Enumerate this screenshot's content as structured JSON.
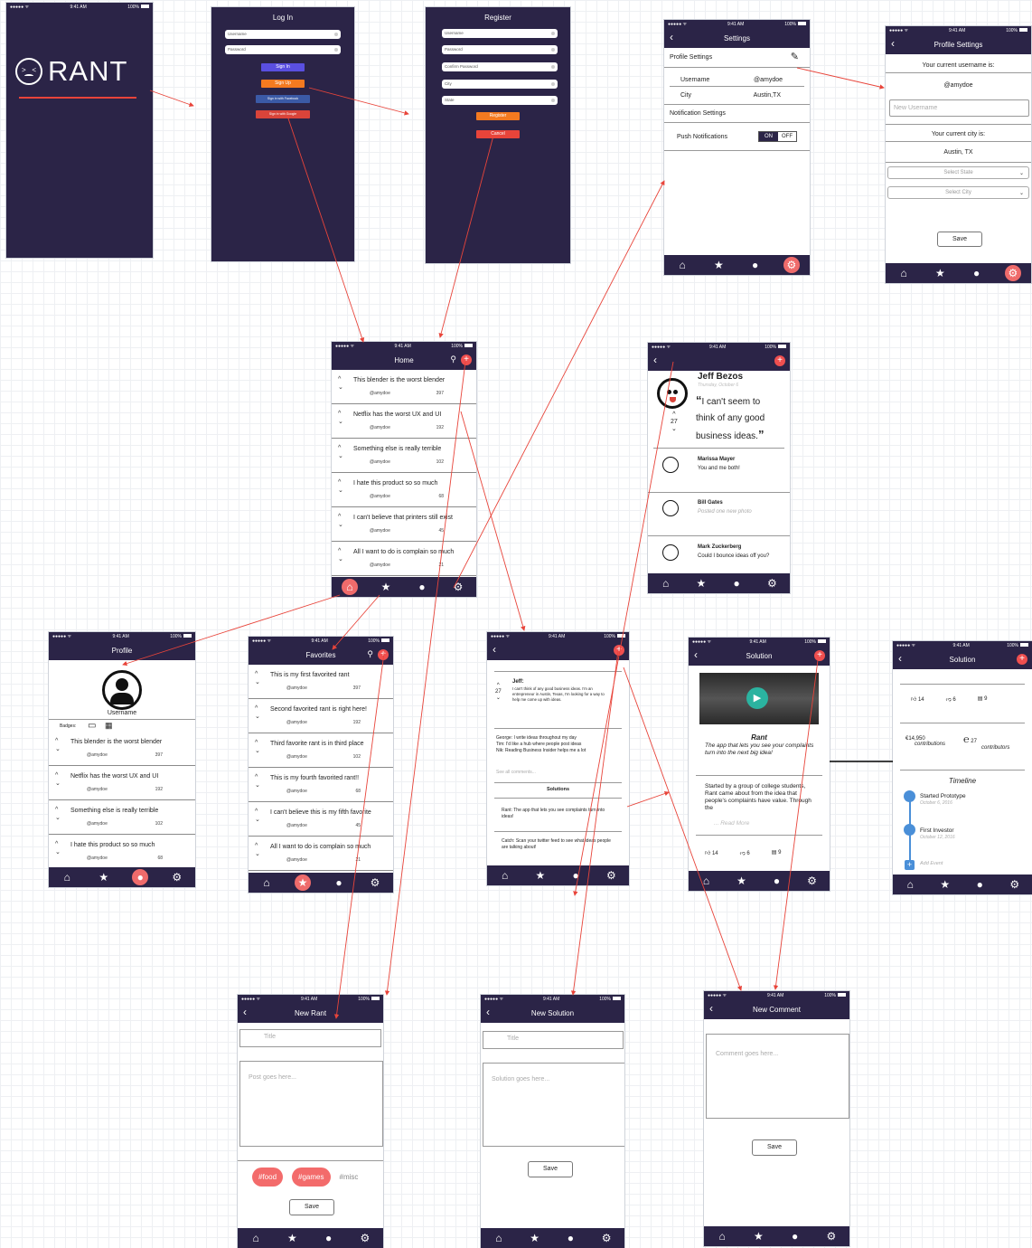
{
  "status": {
    "carrier": "●●●●● ᯤ",
    "time": "9:41 AM",
    "battery": "100%"
  },
  "icons": {
    "home": "home-icon",
    "star": "star-icon",
    "user": "user-icon",
    "gear": "gear-icon",
    "back": "‹",
    "plus": "+",
    "search": "⚲"
  },
  "splash": {
    "logo": "RANT"
  },
  "login": {
    "title": "Log In",
    "username": "Username",
    "password": "Password",
    "sign_in": "Sign In",
    "sign_up": "Sign Up",
    "facebook": "Sign in with Facebook",
    "google": "Sign in with Google"
  },
  "register": {
    "title": "Register",
    "fields": [
      "Username",
      "Password",
      "Confirm Password",
      "City",
      "State"
    ],
    "register": "Register",
    "cancel": "Cancel"
  },
  "settings": {
    "title": "Settings",
    "profile_settings": "Profile Settings",
    "username_label": "Username",
    "username_value": "@amydoe",
    "city_label": "City",
    "city_value": "Austin,TX",
    "notif": "Notification Settings",
    "push": "Push Notifications",
    "on": "ON",
    "off": "OFF"
  },
  "profile_settings": {
    "title": "Profile Settings",
    "cur_user": "Your current username is:",
    "user": "@amydoe",
    "new_user": "New Username",
    "cur_city": "Your current city is:",
    "city": "Austin, TX",
    "state_sel": "Select State",
    "city_sel": "Select City",
    "save": "Save"
  },
  "home": {
    "title": "Home",
    "items": [
      {
        "t": "This blender is the worst blender",
        "u": "@amydoe",
        "n": "397"
      },
      {
        "t": "Netflix has the worst UX and UI",
        "u": "@amydoe",
        "n": "192"
      },
      {
        "t": "Something else is really terrible",
        "u": "@amydoe",
        "n": "102"
      },
      {
        "t": "I hate this product so so much",
        "u": "@amydoe",
        "n": "68"
      },
      {
        "t": "I can't believe that printers still exist",
        "u": "@amydoe",
        "n": "45"
      },
      {
        "t": "All I want to do is complain so much",
        "u": "@amydoe",
        "n": "21"
      }
    ]
  },
  "rant_detail": {
    "name": "Jeff Bezos",
    "date": "Thursday, October 6",
    "quote": "I can't seem to think of any good business ideas.",
    "votes": "27",
    "comments": [
      {
        "name": "Marissa Mayer",
        "text": "You and me both!"
      },
      {
        "name": "Bill Gates",
        "text": "Posted one new photo"
      },
      {
        "name": "Mark Zuckerberg",
        "text": "Could I bounce ideas off you?"
      }
    ]
  },
  "profile": {
    "title": "Profile",
    "username": "Username",
    "badges": "Badges:",
    "items": [
      {
        "t": "This blender is the worst blender",
        "u": "@amydoe",
        "n": "397"
      },
      {
        "t": "Netflix has the worst UX and UI",
        "u": "@amydoe",
        "n": "192"
      },
      {
        "t": "Something else is really terrible",
        "u": "@amydoe",
        "n": "102"
      },
      {
        "t": "I hate this product so so much",
        "u": "@amydoe",
        "n": "68"
      }
    ]
  },
  "favorites": {
    "title": "Favorites",
    "items": [
      {
        "t": "This is my first favorited rant",
        "u": "@amydoe",
        "n": "397"
      },
      {
        "t": "Second favorited rant is right here!",
        "u": "@amydoe",
        "n": "192"
      },
      {
        "t": "Third favorite rant is in third place",
        "u": "@amydoe",
        "n": "102"
      },
      {
        "t": "This is my fourth favorited rant!!",
        "u": "@amydoe",
        "n": "68"
      },
      {
        "t": "I can't believe this is my fifth favorite",
        "u": "@amydoe",
        "n": "45"
      },
      {
        "t": "All I want to do is complain so much",
        "u": "@amydoe",
        "n": "21"
      }
    ]
  },
  "thread": {
    "author": "Jeff:",
    "votes": "27",
    "quote": "I can't think of any good business ideas. I'm an entrepreneur in Austin, Texas, I'm looking for a way to help me come up with ideas.",
    "replies": [
      "George: I write ideas throughout my day",
      "Tim: I'd like a hub where people post ideas",
      "Nik: Reading Business Insider helps me a lot"
    ],
    "see_all": "See all comments...",
    "solutions": "Solutions",
    "sol1": "Rant: The app that lets you see complaints turn into ideas!",
    "sol2": "Catch: Scan your twitter feed to see what ideas people are talking about!"
  },
  "solution": {
    "title": "Solution",
    "name": "Rant",
    "tagline": "The app that lets you see your complaints turn into the next big idea!",
    "body": "Started by a group of college students, Rant came about from the idea that people's complaints have value. Through the",
    "more": "... Read More",
    "likes": "14",
    "dislikes": "6",
    "comments": "9"
  },
  "solution2": {
    "title": "Solution",
    "likes": "14",
    "dislikes": "6",
    "comments": "9",
    "money": "€14,950",
    "money_label": "contributions",
    "contributors": "27",
    "contributors_label": "contributors",
    "timeline": "Timeline",
    "events": [
      {
        "t": "Started Prototype",
        "d": "October 6, 2016"
      },
      {
        "t": "First Investor",
        "d": "October 12, 2016"
      }
    ],
    "add": "Add Event"
  },
  "new_rant": {
    "title": "New Rant",
    "title_ph": "Title",
    "post_ph": "Post goes here...",
    "tags": [
      "#food",
      "#games",
      "#misc"
    ],
    "save": "Save"
  },
  "new_solution": {
    "title": "New Solution",
    "title_ph": "Title",
    "body_ph": "Solution goes here...",
    "save": "Save"
  },
  "new_comment": {
    "title": "New Comment",
    "body_ph": "Comment goes here...",
    "save": "Save"
  },
  "colors": {
    "nav": "#2b2447",
    "accent": "#ef4f4f",
    "orange": "#f47a20",
    "purple": "#5a4fe0",
    "arrow": "#e8443a"
  }
}
